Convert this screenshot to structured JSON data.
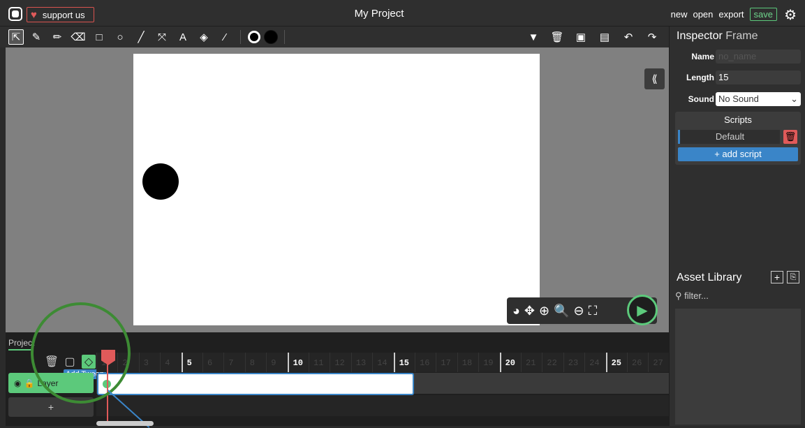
{
  "topbar": {
    "support_label": "support us",
    "project_title": "My Project",
    "actions": [
      "new",
      "open",
      "export",
      "save"
    ]
  },
  "toolbar": {
    "tools": [
      "cursor-icon",
      "brush-icon",
      "pencil-icon",
      "eraser-icon",
      "rectangle-icon",
      "ellipse-icon",
      "line-icon",
      "pathcursor-icon",
      "text-icon",
      "fill-icon",
      "eyedropper-icon"
    ],
    "right_tools": [
      "dropdown-icon",
      "delete-icon",
      "copy-icon",
      "paste-icon",
      "undo-icon",
      "redo-icon"
    ],
    "fill_color": "#000000",
    "stroke_color": "#000000"
  },
  "stage": {
    "collapse_label": "⟪",
    "controls": [
      "onion-skin-icon",
      "pan-icon",
      "zoom-in-icon",
      "zoom-icon",
      "zoom-out-icon",
      "fit-icon",
      "play-icon"
    ]
  },
  "timeline": {
    "tab_label": "Project",
    "tween_tooltip": "Add Tween",
    "layer_name": "Layer",
    "add_layer_label": "+",
    "frame_numbers": [
      "1",
      "2",
      "3",
      "4",
      "5",
      "6",
      "7",
      "8",
      "9",
      "10",
      "11",
      "12",
      "13",
      "14",
      "15",
      "16",
      "17",
      "18",
      "19",
      "20",
      "21",
      "22",
      "23",
      "24",
      "25",
      "26",
      "27"
    ],
    "tween_length": 15
  },
  "inspector": {
    "title": "Inspector",
    "subtitle": "Frame",
    "name_label": "Name",
    "name_placeholder": "no_name",
    "length_label": "Length",
    "length_value": "15",
    "sound_label": "Sound",
    "sound_value": "No Sound",
    "scripts_title": "Scripts",
    "script_default": "Default",
    "add_script_label": "+ add script"
  },
  "asset_library": {
    "title": "Asset Library",
    "filter_placeholder": "filter..."
  },
  "colors": {
    "accent_green": "#5cc97b",
    "accent_blue": "#3a85c8",
    "danger_red": "#e05a5a"
  }
}
